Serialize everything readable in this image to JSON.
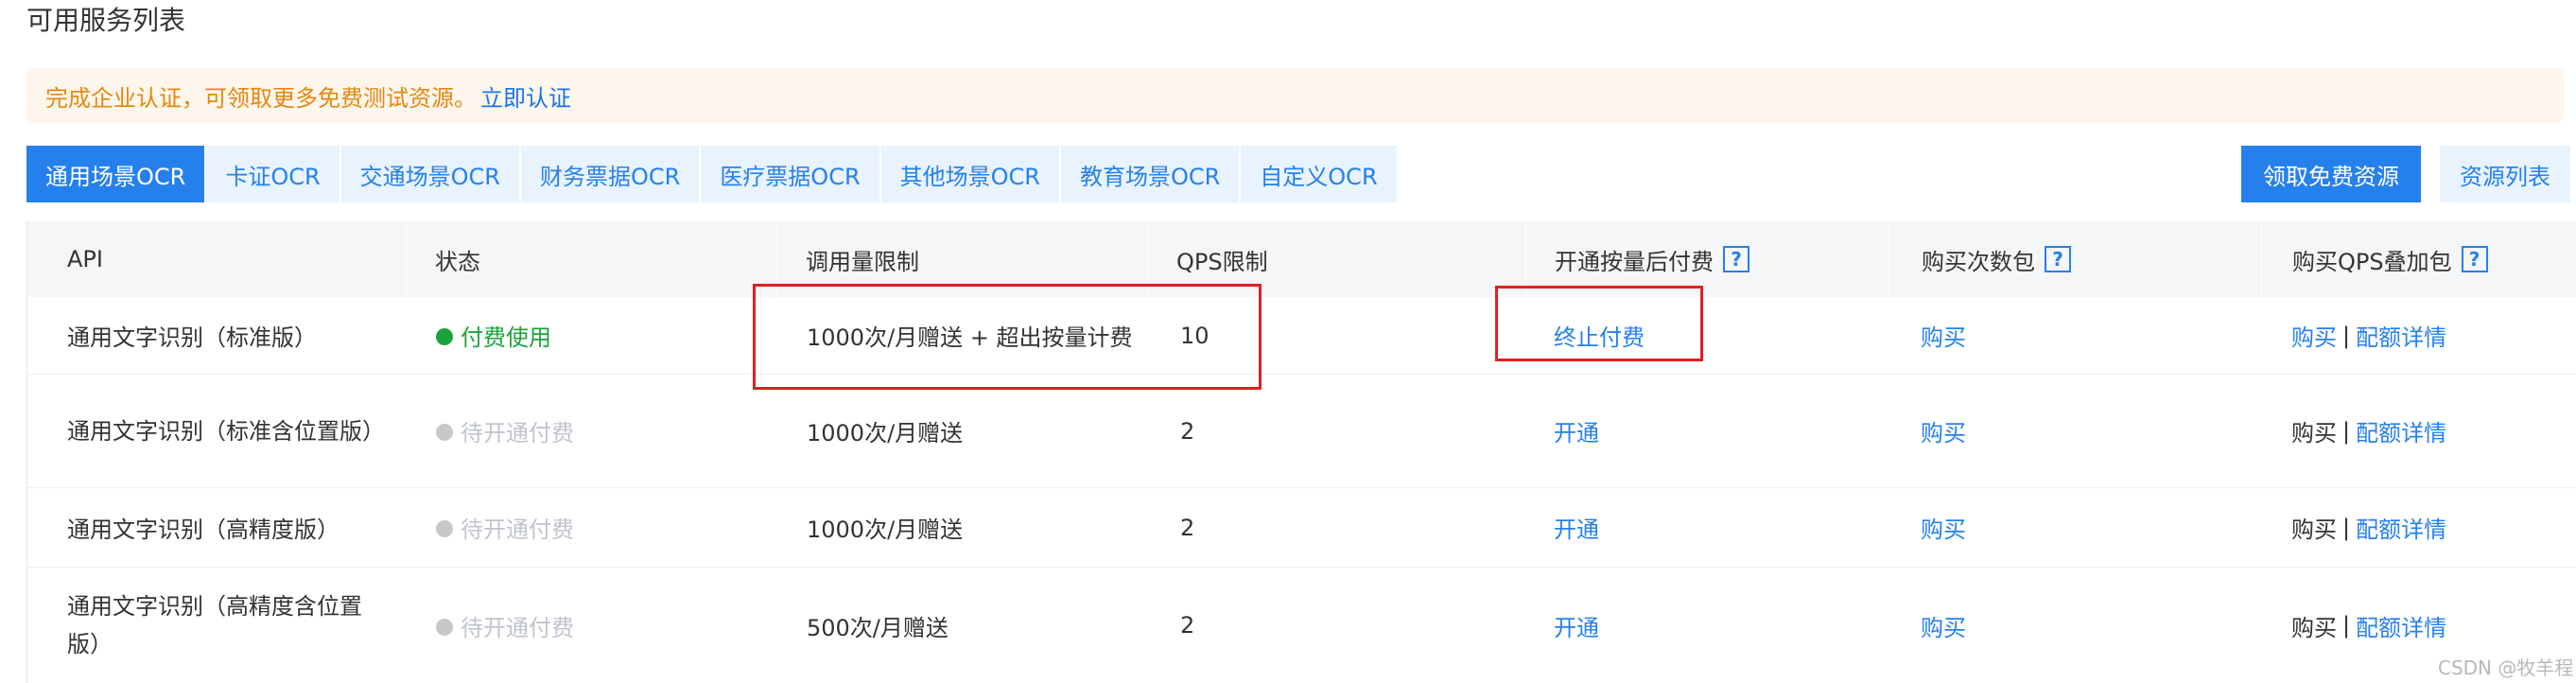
{
  "page_title": "可用服务列表",
  "notice": {
    "message": "完成企业认证，可领取更多免费测试资源。",
    "link": "立即认证"
  },
  "tabs": [
    {
      "label": "通用场景OCR",
      "active": true
    },
    {
      "label": "卡证OCR",
      "active": false
    },
    {
      "label": "交通场景OCR",
      "active": false
    },
    {
      "label": "财务票据OCR",
      "active": false
    },
    {
      "label": "医疗票据OCR",
      "active": false
    },
    {
      "label": "其他场景OCR",
      "active": false
    },
    {
      "label": "教育场景OCR",
      "active": false
    },
    {
      "label": "自定义OCR",
      "active": false
    }
  ],
  "actions": {
    "free_resources": "领取免费资源",
    "resource_list": "资源列表"
  },
  "table": {
    "headers": [
      "API",
      "状态",
      "调用量限制",
      "QPS限制",
      "开通按量后付费",
      "购买次数包",
      "购买QPS叠加包"
    ],
    "help_icon": "?",
    "rows": [
      {
        "api": "通用文字识别（标准版）",
        "status": "付费使用",
        "limit": "1000次/月赠送 + 超出按量计费",
        "qps": "10",
        "postpaid": "终止付费",
        "buy_count": "购买",
        "buy_qps": "购买",
        "separator": "|",
        "quota": "配额详情"
      },
      {
        "api": "通用文字识别（标准含位置版）",
        "status": "待开通付费",
        "limit": "1000次/月赠送",
        "qps": "2",
        "postpaid": "开通",
        "buy_count": "购买",
        "buy_qps": "购买",
        "separator": "|",
        "quota": "配额详情"
      },
      {
        "api": "通用文字识别（高精度版）",
        "status": "待开通付费",
        "limit": "1000次/月赠送",
        "qps": "2",
        "postpaid": "开通",
        "buy_count": "购买",
        "buy_qps": "购买",
        "separator": "|",
        "quota": "配额详情"
      },
      {
        "api": "通用文字识别（高精度含位置版）",
        "status": "待开通付费",
        "limit": "500次/月赠送",
        "qps": "2",
        "postpaid": "开通",
        "buy_count": "购买",
        "buy_qps": "购买",
        "separator": "|",
        "quota": "配额详情"
      }
    ]
  },
  "colors": {
    "primary": "#2680eb",
    "paid_status": "#1aa33a",
    "pending_status": "#c0c4cc",
    "notice_text": "#e6870f",
    "notice_bg": "#fdf6ec",
    "annotation": "#e02020"
  },
  "watermark": "CSDN @牧羊程"
}
